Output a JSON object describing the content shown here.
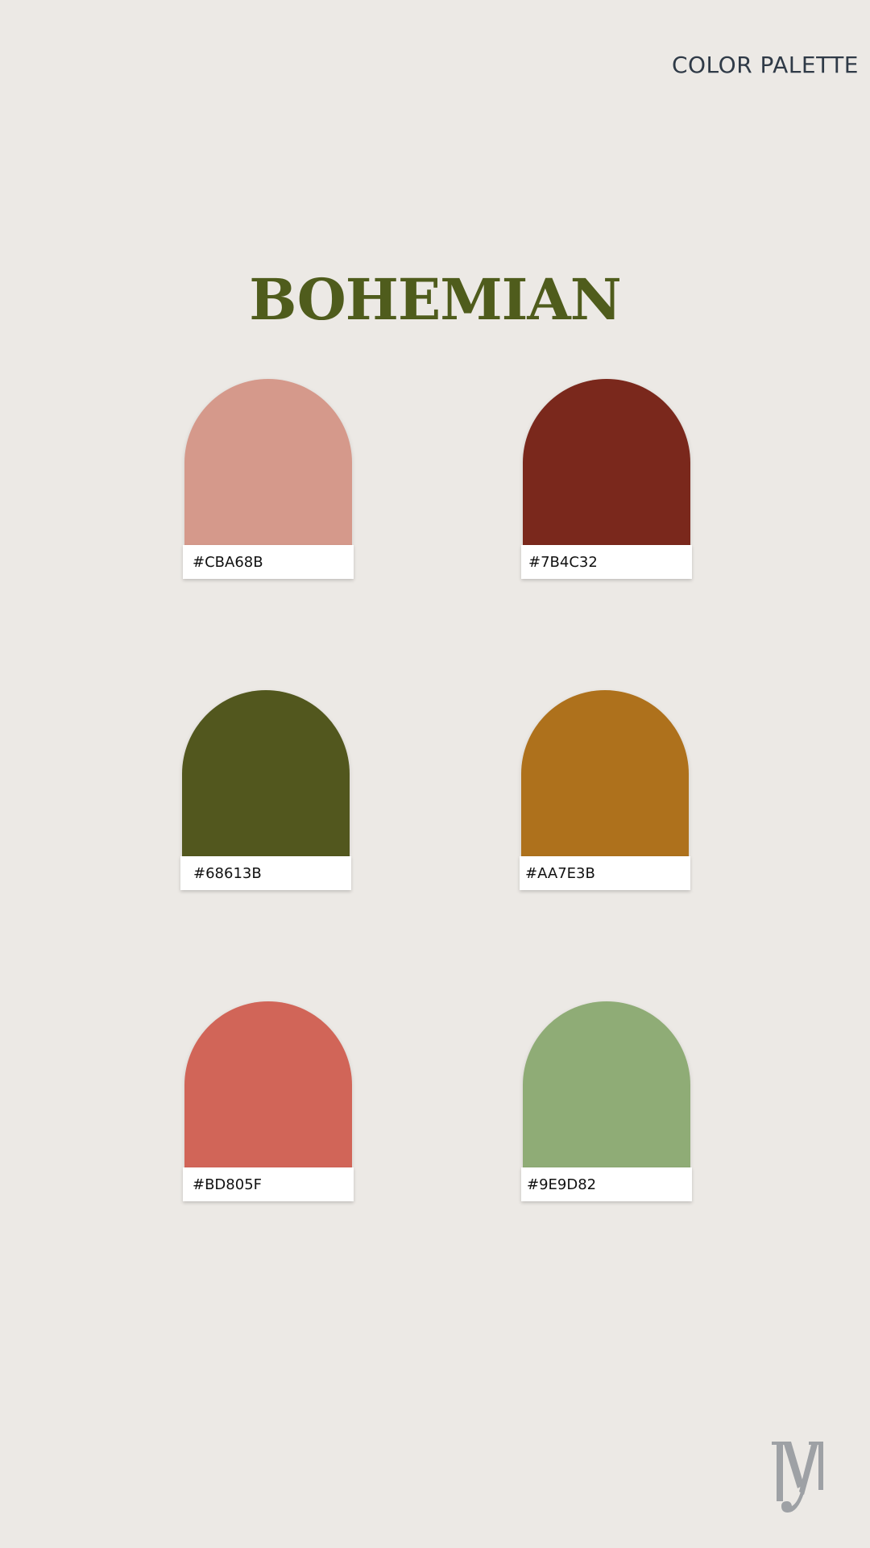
{
  "header": {
    "label": "COLOR PALETTE"
  },
  "title": "BOHEMIAN",
  "swatches": [
    {
      "hex": "#CBA68B",
      "color": "#D5998B"
    },
    {
      "hex": "#7B4C32",
      "color": "#7A281C"
    },
    {
      "hex": "#68613B",
      "color": "#52571E"
    },
    {
      "hex": "#AA7E3B",
      "color": "#AE711C"
    },
    {
      "hex": "#BD805F",
      "color": "#D16558"
    },
    {
      "hex": "#9E9D82",
      "color": "#8FAC76"
    }
  ],
  "logo": {
    "icon": "monogram-y-logo",
    "color": "#9EA1A5"
  }
}
